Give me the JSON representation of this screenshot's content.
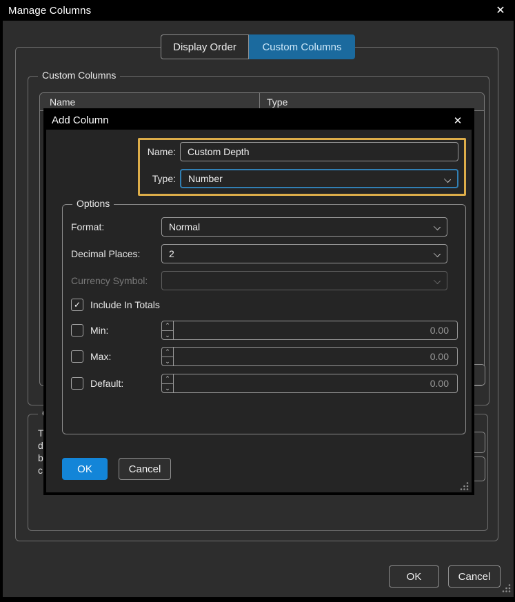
{
  "icons": {
    "close": "✕",
    "check": "✓",
    "spin_up": "⌃",
    "spin_down": "⌄",
    "chevron_down": "⌄"
  },
  "window": {
    "title": "Manage Columns",
    "ok": "OK",
    "cancel": "Cancel"
  },
  "tabs": {
    "display_order": "Display Order",
    "custom_columns": "Custom Columns"
  },
  "manage": {
    "group_label": "Custom Columns",
    "columns": [
      "Name",
      "Type"
    ],
    "background_group_label_fragment": "C",
    "background_text_fragments": [
      "T",
      "d",
      "b",
      "c"
    ]
  },
  "dialog": {
    "title": "Add Column",
    "name_label": "Name:",
    "name_value": "Custom Depth",
    "type_label": "Type:",
    "type_value": "Number",
    "options_label": "Options",
    "format_label": "Format:",
    "format_value": "Normal",
    "decimal_label": "Decimal Places:",
    "decimal_value": "2",
    "currency_label": "Currency Symbol:",
    "currency_value": "",
    "include_totals_label": "Include In Totals",
    "include_totals_checked": true,
    "min_label": "Min:",
    "min_value": "0.00",
    "max_label": "Max:",
    "max_value": "0.00",
    "default_label": "Default:",
    "default_value": "0.00",
    "ok": "OK",
    "cancel": "Cancel"
  },
  "colors": {
    "accent_blue": "#1385d8",
    "tab_active_bg": "#1b6a9e",
    "tab_active_text": "#cde8f9",
    "highlight_yellow": "#ddad49",
    "focus_border_blue": "#3180b5",
    "surface_bg": "#2d2d2d",
    "modal_bg": "#252525"
  }
}
